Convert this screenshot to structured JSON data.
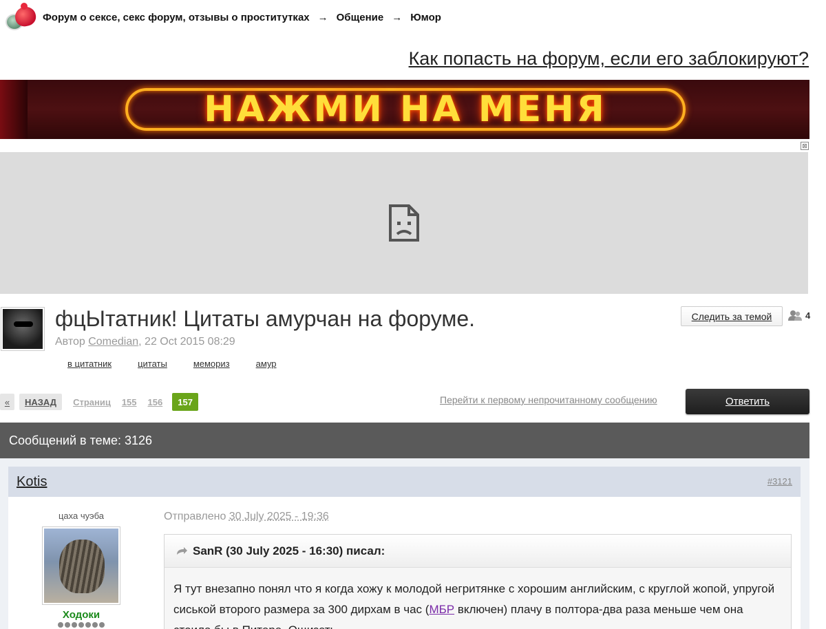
{
  "breadcrumb": {
    "items": [
      "Форум о сексе, секс форум, отзывы о проститутках",
      "Общение",
      "Юмор"
    ],
    "separator": "→"
  },
  "blocked_link": "Как попасть на форум, если его заблокируют?",
  "banner": {
    "text": "НАЖМИ НА МЕНЯ"
  },
  "ad": {
    "close": "⊠",
    "icon": "broken-image-icon"
  },
  "topic": {
    "title": "фцЫтатник! Цитаты амурчан на форуме.",
    "author_prefix": "Автор ",
    "author": "Comedian",
    "date": ", 22 Oct 2015 08:29",
    "tags": [
      "в цитатник",
      "цитаты",
      "мемориз",
      "амур"
    ],
    "follow_label": "Следить за темой",
    "followers_count": "4"
  },
  "pagination": {
    "prev_arrow": "«",
    "back_label": "НАЗАД",
    "pages_label": "Страниц",
    "pages": [
      "155",
      "156"
    ],
    "current": "157",
    "unread_link": "Перейти к первому непрочитанному сообщению",
    "reply_label": "Ответить"
  },
  "count_bar": "Сообщений в теме: 3126",
  "post": {
    "author": "Kotis",
    "number": "#3121",
    "user_title": "цаха чуэба",
    "user_group": "Ходоки",
    "sent_prefix": "Отправлено ",
    "sent_date": "30 July 2025 - 19:36",
    "quote_header": "SanR (30 July 2025 - 16:30) писал:",
    "quote_text_1": "Я тут внезапно понял что я когда хожу к молодой негритянке с хорошим английским, с круглой жопой, упругой сиськой второго размера за 300 дирхам в час (",
    "quote_link": "МБР",
    "quote_text_2": " включен) плачу в полтора-два раза меньше чем она стоила бы в Питере. Ощизеть."
  },
  "colors": {
    "accent_green": "#6aa51a",
    "count_bar_bg": "#5a5a5a",
    "post_head_bg": "#d7dde8",
    "user_group": "#1a8a1a"
  }
}
